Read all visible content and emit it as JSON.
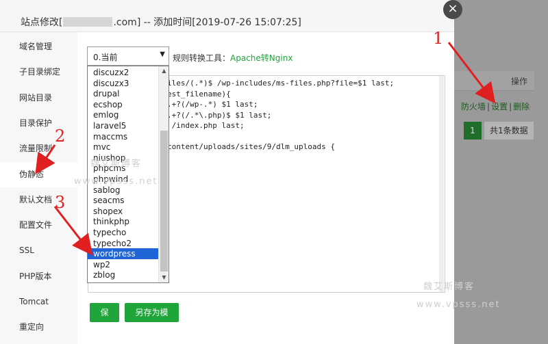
{
  "background": {
    "op_header": "操作",
    "actions": [
      "防火墙",
      "设置",
      "删除"
    ],
    "action_separator": "|",
    "pager_page": "1",
    "pager_total": "共1条数据"
  },
  "modal": {
    "title_prefix": "站点修改[",
    "title_suffix": ".com] -- 添加时间[2019-07-26 15:07:25]",
    "close_symbol": "×"
  },
  "sidebar": {
    "items": [
      {
        "label": "域名管理"
      },
      {
        "label": "子目录绑定"
      },
      {
        "label": "网站目录"
      },
      {
        "label": "目录保护"
      },
      {
        "label": "流量限制"
      },
      {
        "label": "伪静态"
      },
      {
        "label": "默认文档"
      },
      {
        "label": "配置文件"
      },
      {
        "label": "SSL"
      },
      {
        "label": "PHP版本"
      },
      {
        "label": "Tomcat"
      },
      {
        "label": "重定向"
      }
    ],
    "active_index": 5
  },
  "rewrite": {
    "select_value": "0.当前",
    "rule_label": "规则转换工具：",
    "rule_link": "Apache转Nginx",
    "options": [
      "discuzx2",
      "discuzx3",
      "drupal",
      "ecshop",
      "emlog",
      "laravel5",
      "maccms",
      "mvc",
      "niushop",
      "phpcms",
      "phpwind",
      "sablog",
      "seacms",
      "shopex",
      "thinkphp",
      "typecho",
      "typecho2",
      "wordpress",
      "wp2",
      "zblog"
    ],
    "selected_option": "wordpress",
    "code_lines": [
      "iles/(.*)$ /wp-includes/ms-files.php?file=$1 last;",
      "est_filename){",
      ".+?(/wp-.*) $1 last;",
      ".+?(/.*\\.php)$ $1 last;",
      " /index.php last;",
      "",
      "content/uploads/sites/9/dlm_uploads {"
    ],
    "save_label": "保存",
    "save_template_label": "另存为模板"
  },
  "annotations": [
    "1",
    "2",
    "3"
  ],
  "watermarks": {
    "cn": "魏艾斯博客",
    "url": "www.vpsss.net"
  },
  "colors": {
    "accent": "#20a53a",
    "selection": "#1e64d6",
    "annotation": "#e02020"
  }
}
